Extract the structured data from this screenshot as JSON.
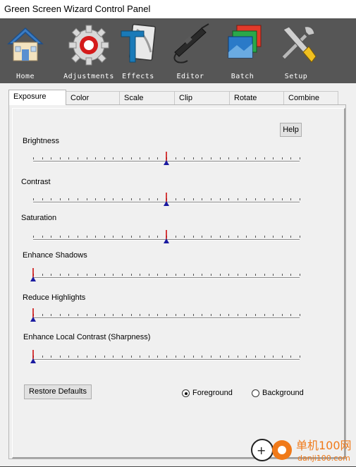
{
  "window": {
    "title": "Green Screen Wizard Control Panel"
  },
  "toolbar": {
    "items": [
      {
        "label": "Home",
        "icon": "house-icon"
      },
      {
        "label": "Adjustments",
        "icon": "gear-icon"
      },
      {
        "label": "Effects",
        "icon": "text-effect-icon"
      },
      {
        "label": "Editor",
        "icon": "airbrush-icon"
      },
      {
        "label": "Batch",
        "icon": "stacked-photos-icon"
      },
      {
        "label": "Setup",
        "icon": "tools-icon"
      }
    ]
  },
  "tabs": [
    {
      "label": "Exposure",
      "active": true
    },
    {
      "label": "Color",
      "active": false
    },
    {
      "label": "Scale",
      "active": false
    },
    {
      "label": "Clip",
      "active": false
    },
    {
      "label": "Rotate",
      "active": false
    },
    {
      "label": "Combine",
      "active": false
    }
  ],
  "exposure": {
    "help_label": "Help",
    "sliders": [
      {
        "label": "Brightness",
        "value": 0.5
      },
      {
        "label": "Contrast",
        "value": 0.5
      },
      {
        "label": "Saturation",
        "value": 0.5
      },
      {
        "label": "Enhance Shadows",
        "value": 0
      },
      {
        "label": "Reduce Highlights",
        "value": 0
      },
      {
        "label": "Enhance Local Contrast (Sharpness)",
        "value": 0
      }
    ],
    "restore_label": "Restore Defaults",
    "target": {
      "options": [
        "Foreground",
        "Background"
      ],
      "selected": "Foreground"
    }
  },
  "watermark": {
    "text_cn": "单机100网",
    "text_url": "danji100.com"
  },
  "colors": {
    "toolbar_bg": "#565656",
    "thumb_red": "#cc0000",
    "thumb_blue": "#1a1aa0"
  }
}
